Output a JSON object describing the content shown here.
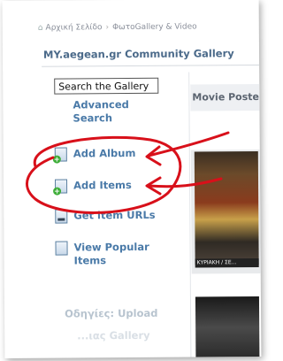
{
  "breadcrumb": [
    "Αρχική Σελίδο",
    "ΦωτοGallery & Video"
  ],
  "site_title": "MY.aegean.gr Community Gallery",
  "search": {
    "placeholder": "Search the Gallery"
  },
  "sidebar": {
    "advanced_search": "Advanced Search",
    "items": [
      {
        "label": "Add Album",
        "icon": "add-album-icon"
      },
      {
        "label": "Add Items",
        "icon": "add-items-icon"
      },
      {
        "label": "Get item URLs",
        "icon": "get-urls-icon"
      },
      {
        "label": "View Popular Items",
        "icon": "popular-items-icon"
      }
    ],
    "help_text": "Οδηγίες: Upload",
    "help_text2": "...ιας Gallery"
  },
  "main": {
    "header": "Movie Posters",
    "thumb_caption": "ΚΥΡΙΑΚΗ / ΣΕ..."
  },
  "annotation": {
    "color": "#d8101a"
  }
}
